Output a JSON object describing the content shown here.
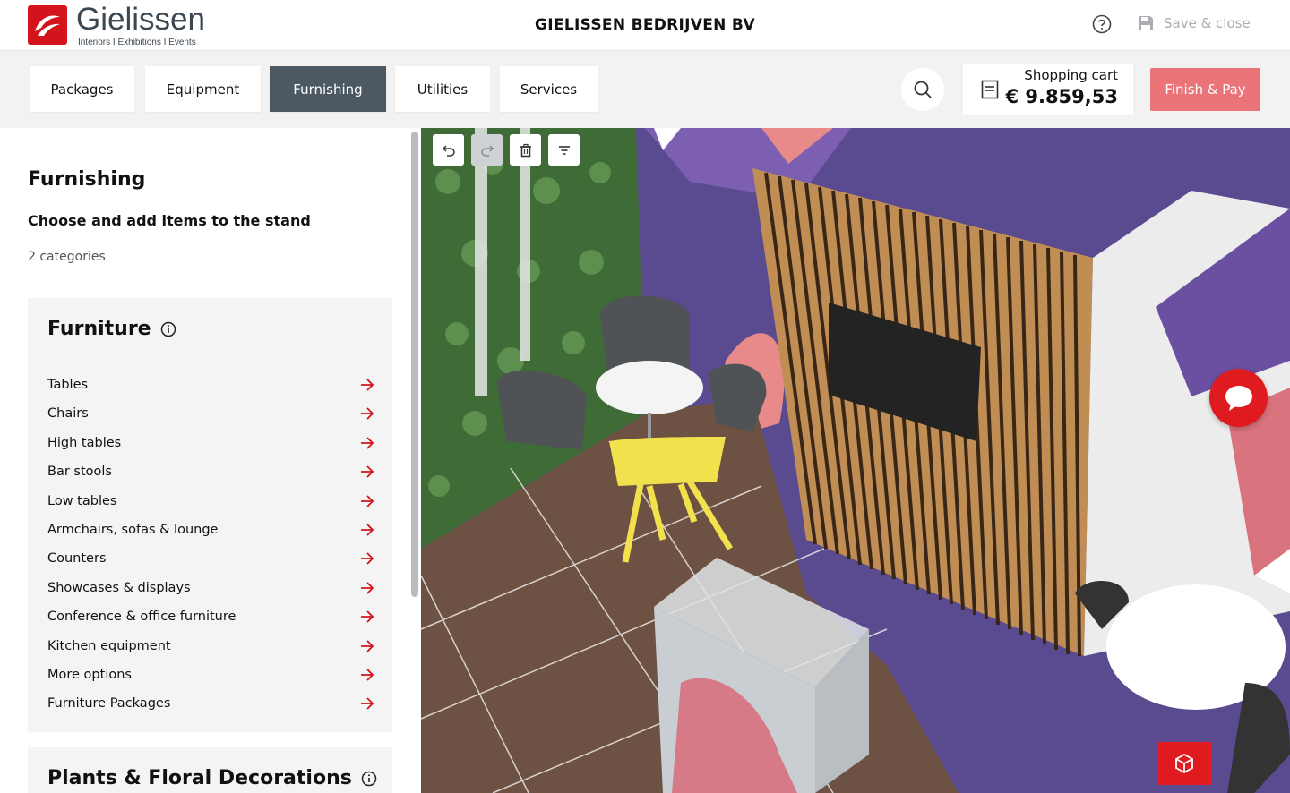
{
  "header": {
    "logo_name": "Gielissen",
    "logo_sub": "Interiors  I  Exhibitions  I  Events",
    "company": "GIELISSEN BEDRIJVEN BV",
    "save_close": "Save & close"
  },
  "nav": {
    "tabs": [
      {
        "label": "Packages"
      },
      {
        "label": "Equipment"
      },
      {
        "label": "Furnishing"
      },
      {
        "label": "Utilities"
      },
      {
        "label": "Services"
      }
    ],
    "active_tab": "Furnishing",
    "cart_label": "Shopping cart",
    "cart_value": "€ 9.859,53",
    "finish_label": "Finish & Pay"
  },
  "panel": {
    "title": "Furnishing",
    "subtitle": "Choose and add items to the stand",
    "count": "2 categories",
    "categories": [
      {
        "title": "Furniture",
        "items": [
          "Tables",
          "Chairs",
          "High tables",
          "Bar stools",
          "Low tables",
          "Armchairs, sofas & lounge",
          "Counters",
          "Showcases & displays",
          "Conference & office furniture",
          "Kitchen equipment",
          "More options",
          "Furniture Packages"
        ]
      },
      {
        "title": "Plants & Floral Decorations",
        "items": []
      }
    ]
  },
  "colors": {
    "brand_red": "#d4141c",
    "active_tab": "#4c5862",
    "finish_button": "#ea7478",
    "arrow": "#d4141c"
  },
  "icons": {
    "toolbar": [
      "undo-icon",
      "redo-icon",
      "trash-icon",
      "filter-icon"
    ],
    "chat": "chat-bubble-icon",
    "view": "cube-icon"
  }
}
